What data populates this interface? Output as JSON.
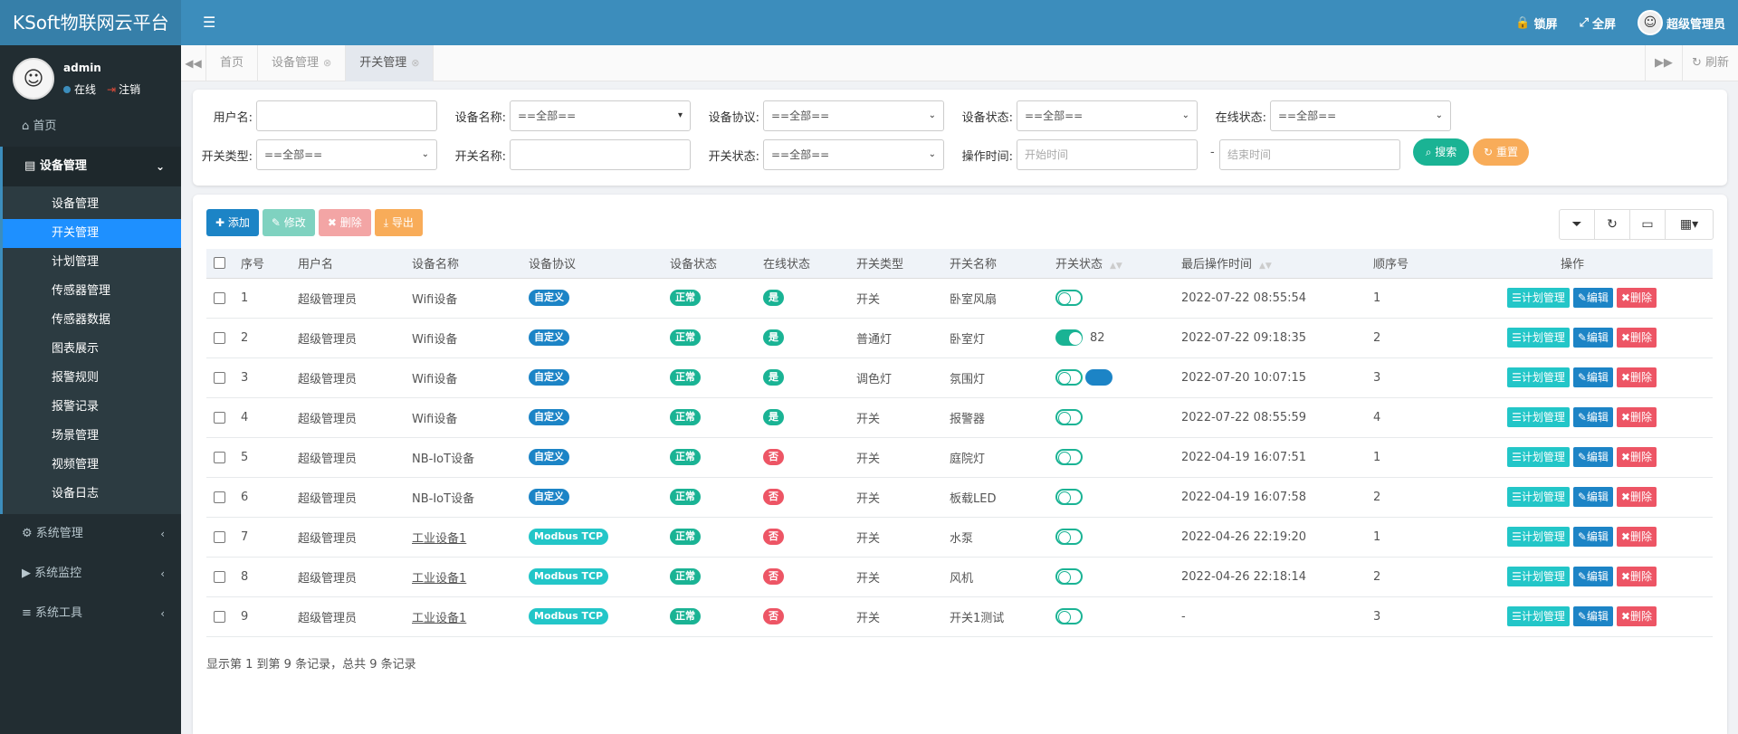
{
  "brand": "KSoft物联网云平台",
  "topbar": {
    "lock_label": "锁屏",
    "fullscreen_label": "全屏",
    "user_label": "超级管理员"
  },
  "user": {
    "name": "admin",
    "online_label": "在线",
    "logout_label": "注销"
  },
  "sidebar": {
    "home": "首页",
    "device_group": "设备管理",
    "sub_items": [
      "设备管理",
      "开关管理",
      "计划管理",
      "传感器管理",
      "传感器数据",
      "图表展示",
      "报警规则",
      "报警记录",
      "场景管理",
      "视频管理",
      "设备日志"
    ],
    "system_manage": "系统管理",
    "system_monitor": "系统监控",
    "system_tools": "系统工具"
  },
  "tabs": {
    "home": "首页",
    "device": "设备管理",
    "switch": "开关管理",
    "refresh": "刷新"
  },
  "search": {
    "username_label": "用户名:",
    "devname_label": "设备名称:",
    "devname_value": "==全部==",
    "protocol_label": "设备协议:",
    "protocol_value": "==全部==",
    "devstatus_label": "设备状态:",
    "devstatus_value": "==全部==",
    "online_label": "在线状态:",
    "online_value": "==全部==",
    "swtype_label": "开关类型:",
    "swtype_value": "==全部==",
    "swname_label": "开关名称:",
    "swstatus_label": "开关状态:",
    "swstatus_value": "==全部==",
    "optime_label": "操作时间:",
    "start_placeholder": "开始时间",
    "dash": "-",
    "end_placeholder": "结束时间",
    "search_btn": "搜索",
    "reset_btn": "重置"
  },
  "toolbar": {
    "add": "添加",
    "edit": "修改",
    "delete": "删除",
    "export": "导出"
  },
  "table": {
    "headers": [
      "序号",
      "用户名",
      "设备名称",
      "设备协议",
      "设备状态",
      "在线状态",
      "开关类型",
      "开关名称",
      "开关状态",
      "最后操作时间",
      "顺序号",
      "操作"
    ],
    "rows": [
      {
        "no": "1",
        "user": "超级管理员",
        "device": "Wifi设备",
        "protocol": "自定义",
        "status": "正常",
        "online": "是",
        "type": "开关",
        "name": "卧室风扇",
        "switch_on": false,
        "switch_value": "",
        "time": "2022-07-22 08:55:54",
        "order": "1"
      },
      {
        "no": "2",
        "user": "超级管理员",
        "device": "Wifi设备",
        "protocol": "自定义",
        "status": "正常",
        "online": "是",
        "type": "普通灯",
        "name": "卧室灯",
        "switch_on": true,
        "switch_value": "82",
        "time": "2022-07-22 09:18:35",
        "order": "2"
      },
      {
        "no": "3",
        "user": "超级管理员",
        "device": "Wifi设备",
        "protocol": "自定义",
        "status": "正常",
        "online": "是",
        "type": "调色灯",
        "name": "氛围灯",
        "switch_on": false,
        "switch_value": "",
        "time": "2022-07-20 10:07:15",
        "order": "3"
      },
      {
        "no": "4",
        "user": "超级管理员",
        "device": "Wifi设备",
        "protocol": "自定义",
        "status": "正常",
        "online": "是",
        "type": "开关",
        "name": "报警器",
        "switch_on": false,
        "switch_value": "",
        "time": "2022-07-22 08:55:59",
        "order": "4"
      },
      {
        "no": "5",
        "user": "超级管理员",
        "device": "NB-IoT设备",
        "protocol": "自定义",
        "status": "正常",
        "online": "否",
        "type": "开关",
        "name": "庭院灯",
        "switch_on": false,
        "switch_value": "",
        "time": "2022-04-19 16:07:51",
        "order": "1"
      },
      {
        "no": "6",
        "user": "超级管理员",
        "device": "NB-IoT设备",
        "protocol": "自定义",
        "status": "正常",
        "online": "否",
        "type": "开关",
        "name": "板载LED",
        "switch_on": false,
        "switch_value": "",
        "time": "2022-04-19 16:07:58",
        "order": "2"
      },
      {
        "no": "7",
        "user": "超级管理员",
        "device": "工业设备1",
        "protocol": "Modbus TCP",
        "status": "正常",
        "online": "否",
        "type": "开关",
        "name": "水泵",
        "switch_on": false,
        "switch_value": "",
        "time": "2022-04-26 22:19:20",
        "order": "1"
      },
      {
        "no": "8",
        "user": "超级管理员",
        "device": "工业设备1",
        "protocol": "Modbus TCP",
        "status": "正常",
        "online": "否",
        "type": "开关",
        "name": "风机",
        "switch_on": false,
        "switch_value": "",
        "time": "2022-04-26 22:18:14",
        "order": "2"
      },
      {
        "no": "9",
        "user": "超级管理员",
        "device": "工业设备1",
        "protocol": "Modbus TCP",
        "status": "正常",
        "online": "否",
        "type": "开关",
        "name": "开关1测试",
        "switch_on": false,
        "switch_value": "",
        "time": "-",
        "order": "3"
      }
    ],
    "op_plan": "计划管理",
    "op_edit": "编辑",
    "op_delete": "删除"
  },
  "pager_text": "显示第 1 到第 9 条记录，总共 9 条记录",
  "colors": {
    "header": "#3c8dbc",
    "sidebar": "#222d32",
    "active_sub": "#1e90ff",
    "green": "#1ab394",
    "blue": "#1c84c6",
    "teal": "#23c6c8",
    "red": "#ed5565",
    "orange": "#f8ac59"
  }
}
